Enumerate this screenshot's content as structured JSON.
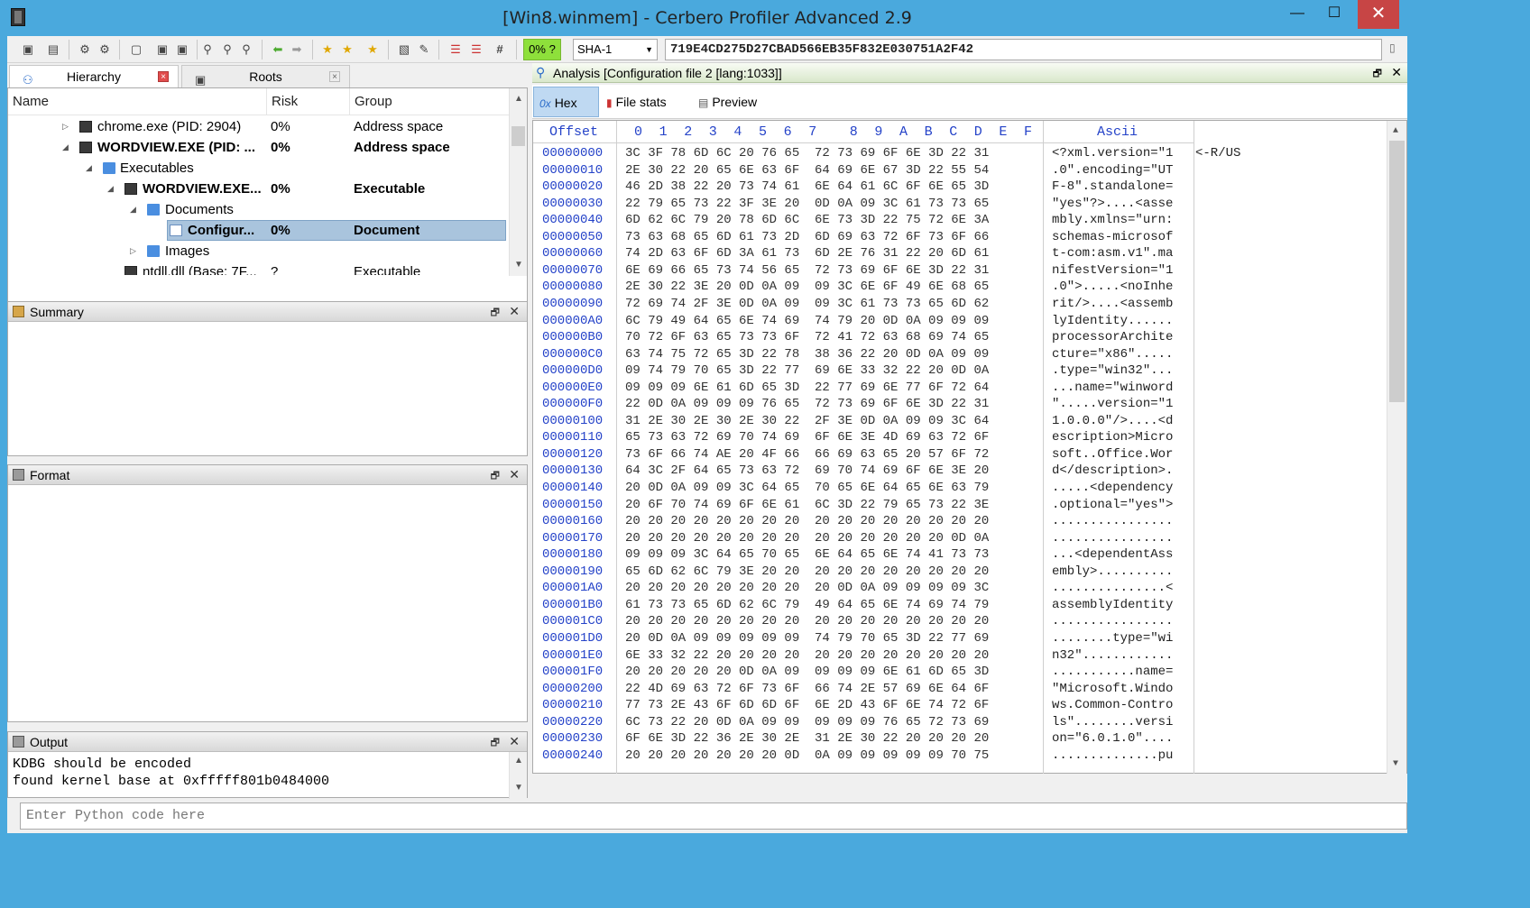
{
  "window": {
    "title": "[Win8.winmem] - Cerbero Profiler Advanced 2.9",
    "minimize": "—",
    "maximize": "☐",
    "close": "✕"
  },
  "toolbar": {
    "risk_badge": "0% ?",
    "hash_algorithm": "SHA-1",
    "hash_value": "719E4CD275D27CBAD566EB35F832E030751A2F42",
    "hash_symbol": "#"
  },
  "left_tabs": [
    {
      "label": "Hierarchy"
    },
    {
      "label": "Roots"
    }
  ],
  "tree": {
    "columns": [
      "Name",
      "Risk",
      "Group"
    ],
    "rows": [
      {
        "name": "chrome.exe (PID: 2904)",
        "risk": "0%",
        "group": "Address space",
        "bold": false,
        "expander": "▷"
      },
      {
        "name": "WORDVIEW.EXE (PID: ...",
        "risk": "0%",
        "group": "Address space",
        "bold": true,
        "expander": "◢"
      },
      {
        "name": "Executables",
        "risk": "",
        "group": "",
        "bold": false,
        "expander": "◢"
      },
      {
        "name": "WORDVIEW.EXE...",
        "risk": "0%",
        "group": "Executable",
        "bold": true,
        "expander": "◢"
      },
      {
        "name": "Documents",
        "risk": "",
        "group": "",
        "bold": false,
        "expander": "◢"
      },
      {
        "name": "Configur...",
        "risk": "0%",
        "group": "Document",
        "bold": true,
        "expander": ""
      },
      {
        "name": "Images",
        "risk": "",
        "group": "",
        "bold": false,
        "expander": "▷"
      },
      {
        "name": "ntdll.dll (Base: 7F...",
        "risk": "?",
        "group": "Executable",
        "bold": false,
        "expander": ""
      }
    ]
  },
  "panels": {
    "summary": "Summary",
    "format": "Format",
    "output": "Output"
  },
  "output": {
    "lines": "KDBG should be encoded\nfound kernel base at 0xfffff801b0484000"
  },
  "python_input": {
    "placeholder": "Enter Python code here"
  },
  "analysis": {
    "title": "Analysis [Configuration file 2 [lang:1033]]",
    "view_tabs": [
      {
        "label": "Hex",
        "icon": "0x"
      },
      {
        "label": "File stats",
        "icon": "▮"
      },
      {
        "label": "Preview",
        "icon": "▤"
      }
    ]
  },
  "hex": {
    "offset_label": "Offset",
    "ascii_label": "Ascii",
    "column_labels": [
      "0",
      "1",
      "2",
      "3",
      "4",
      "5",
      "6",
      "7",
      "8",
      "9",
      "A",
      "B",
      "C",
      "D",
      "E",
      "F"
    ],
    "rows": [
      {
        "off": "00000000",
        "bytes": "3C 3F 78 6D 6C 20 76 65  72 73 69 6F 6E 3D 22 31",
        "ascii": "<?xml.version=\"1",
        "extra": "<-R/US"
      },
      {
        "off": "00000010",
        "bytes": "2E 30 22 20 65 6E 63 6F  64 69 6E 67 3D 22 55 54",
        "ascii": ".0\".encoding=\"UT"
      },
      {
        "off": "00000020",
        "bytes": "46 2D 38 22 20 73 74 61  6E 64 61 6C 6F 6E 65 3D",
        "ascii": "F-8\".standalone="
      },
      {
        "off": "00000030",
        "bytes": "22 79 65 73 22 3F 3E 20  0D 0A 09 3C 61 73 73 65",
        "ascii": "\"yes\"?>....<asse"
      },
      {
        "off": "00000040",
        "bytes": "6D 62 6C 79 20 78 6D 6C  6E 73 3D 22 75 72 6E 3A",
        "ascii": "mbly.xmlns=\"urn:"
      },
      {
        "off": "00000050",
        "bytes": "73 63 68 65 6D 61 73 2D  6D 69 63 72 6F 73 6F 66",
        "ascii": "schemas-microsof"
      },
      {
        "off": "00000060",
        "bytes": "74 2D 63 6F 6D 3A 61 73  6D 2E 76 31 22 20 6D 61",
        "ascii": "t-com:asm.v1\".ma"
      },
      {
        "off": "00000070",
        "bytes": "6E 69 66 65 73 74 56 65  72 73 69 6F 6E 3D 22 31",
        "ascii": "nifestVersion=\"1"
      },
      {
        "off": "00000080",
        "bytes": "2E 30 22 3E 20 0D 0A 09  09 3C 6E 6F 49 6E 68 65",
        "ascii": ".0\">.....<noInhe"
      },
      {
        "off": "00000090",
        "bytes": "72 69 74 2F 3E 0D 0A 09  09 3C 61 73 73 65 6D 62",
        "ascii": "rit/>....<assemb"
      },
      {
        "off": "000000A0",
        "bytes": "6C 79 49 64 65 6E 74 69  74 79 20 0D 0A 09 09 09",
        "ascii": "lyIdentity......"
      },
      {
        "off": "000000B0",
        "bytes": "70 72 6F 63 65 73 73 6F  72 41 72 63 68 69 74 65",
        "ascii": "processorArchite"
      },
      {
        "off": "000000C0",
        "bytes": "63 74 75 72 65 3D 22 78  38 36 22 20 0D 0A 09 09",
        "ascii": "cture=\"x86\"....."
      },
      {
        "off": "000000D0",
        "bytes": "09 74 79 70 65 3D 22 77  69 6E 33 32 22 20 0D 0A",
        "ascii": ".type=\"win32\"..."
      },
      {
        "off": "000000E0",
        "bytes": "09 09 09 6E 61 6D 65 3D  22 77 69 6E 77 6F 72 64",
        "ascii": "...name=\"winword"
      },
      {
        "off": "000000F0",
        "bytes": "22 0D 0A 09 09 09 76 65  72 73 69 6F 6E 3D 22 31",
        "ascii": "\".....version=\"1"
      },
      {
        "off": "00000100",
        "bytes": "31 2E 30 2E 30 2E 30 22  2F 3E 0D 0A 09 09 3C 64",
        "ascii": "1.0.0.0\"/>....<d"
      },
      {
        "off": "00000110",
        "bytes": "65 73 63 72 69 70 74 69  6F 6E 3E 4D 69 63 72 6F",
        "ascii": "escription>Micro"
      },
      {
        "off": "00000120",
        "bytes": "73 6F 66 74 AE 20 4F 66  66 69 63 65 20 57 6F 72",
        "ascii": "soft..Office.Wor"
      },
      {
        "off": "00000130",
        "bytes": "64 3C 2F 64 65 73 63 72  69 70 74 69 6F 6E 3E 20",
        "ascii": "d</description>."
      },
      {
        "off": "00000140",
        "bytes": "20 0D 0A 09 09 3C 64 65  70 65 6E 64 65 6E 63 79",
        "ascii": ".....<dependency"
      },
      {
        "off": "00000150",
        "bytes": "20 6F 70 74 69 6F 6E 61  6C 3D 22 79 65 73 22 3E",
        "ascii": ".optional=\"yes\">"
      },
      {
        "off": "00000160",
        "bytes": "20 20 20 20 20 20 20 20  20 20 20 20 20 20 20 20",
        "ascii": "................"
      },
      {
        "off": "00000170",
        "bytes": "20 20 20 20 20 20 20 20  20 20 20 20 20 20 0D 0A",
        "ascii": "................"
      },
      {
        "off": "00000180",
        "bytes": "09 09 09 3C 64 65 70 65  6E 64 65 6E 74 41 73 73",
        "ascii": "...<dependentAss"
      },
      {
        "off": "00000190",
        "bytes": "65 6D 62 6C 79 3E 20 20  20 20 20 20 20 20 20 20",
        "ascii": "embly>.........."
      },
      {
        "off": "000001A0",
        "bytes": "20 20 20 20 20 20 20 20  20 0D 0A 09 09 09 09 3C",
        "ascii": "...............<"
      },
      {
        "off": "000001B0",
        "bytes": "61 73 73 65 6D 62 6C 79  49 64 65 6E 74 69 74 79",
        "ascii": "assemblyIdentity"
      },
      {
        "off": "000001C0",
        "bytes": "20 20 20 20 20 20 20 20  20 20 20 20 20 20 20 20",
        "ascii": "................"
      },
      {
        "off": "000001D0",
        "bytes": "20 0D 0A 09 09 09 09 09  74 79 70 65 3D 22 77 69",
        "ascii": "........type=\"wi"
      },
      {
        "off": "000001E0",
        "bytes": "6E 33 32 22 20 20 20 20  20 20 20 20 20 20 20 20",
        "ascii": "n32\"............"
      },
      {
        "off": "000001F0",
        "bytes": "20 20 20 20 20 0D 0A 09  09 09 09 6E 61 6D 65 3D",
        "ascii": "...........name="
      },
      {
        "off": "00000200",
        "bytes": "22 4D 69 63 72 6F 73 6F  66 74 2E 57 69 6E 64 6F",
        "ascii": "\"Microsoft.Windo"
      },
      {
        "off": "00000210",
        "bytes": "77 73 2E 43 6F 6D 6D 6F  6E 2D 43 6F 6E 74 72 6F",
        "ascii": "ws.Common-Contro"
      },
      {
        "off": "00000220",
        "bytes": "6C 73 22 20 0D 0A 09 09  09 09 09 76 65 72 73 69",
        "ascii": "ls\"........versi"
      },
      {
        "off": "00000230",
        "bytes": "6F 6E 3D 22 36 2E 30 2E  31 2E 30 22 20 20 20 20",
        "ascii": "on=\"6.0.1.0\"...."
      },
      {
        "off": "00000240",
        "bytes": "20 20 20 20 20 20 20 0D  0A 09 09 09 09 09 70 75",
        "ascii": "..............pu"
      }
    ]
  }
}
